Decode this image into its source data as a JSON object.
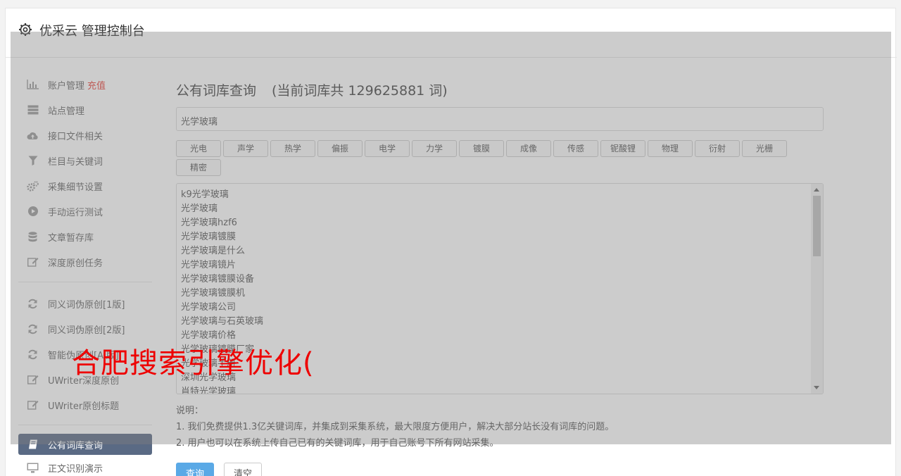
{
  "header": {
    "title": "优采云 管理控制台",
    "icon": "gear-icon"
  },
  "sidebar": {
    "items": [
      {
        "label": "账户管理",
        "tag": "充值",
        "icon": "bar-chart-icon"
      },
      {
        "label": "站点管理",
        "icon": "server-icon"
      },
      {
        "label": "接口文件相关",
        "icon": "cloud-upload-icon"
      },
      {
        "label": "栏目与关键词",
        "icon": "filter-icon"
      },
      {
        "label": "采集细节设置",
        "icon": "cogs-icon"
      },
      {
        "label": "手动运行测试",
        "icon": "play-circle-icon"
      },
      {
        "label": "文章暂存库",
        "icon": "database-icon"
      },
      {
        "label": "深度原创任务",
        "icon": "edit-icon"
      }
    ],
    "items2": [
      {
        "label": "同义词伪原创[1版]",
        "icon": "refresh-icon"
      },
      {
        "label": "同义词伪原创[2版]",
        "icon": "refresh-icon"
      },
      {
        "label": "智能伪原创[AI版]",
        "icon": "refresh-icon"
      },
      {
        "label": "UWriter深度原创",
        "icon": "edit-icon"
      },
      {
        "label": "UWriter原创标题",
        "icon": "edit-icon"
      }
    ],
    "items3": [
      {
        "label": "公有词库查询",
        "icon": "book-icon",
        "active": true
      },
      {
        "label": "正文识别演示",
        "icon": "monitor-icon"
      }
    ]
  },
  "main": {
    "title": "公有词库查询",
    "count_text": "(当前词库共 129625881 词)",
    "search_value": "光学玻璃",
    "categories": [
      "光电",
      "声学",
      "热学",
      "偏振",
      "电学",
      "力学",
      "镀膜",
      "成像",
      "传感",
      "铌酸锂",
      "物理",
      "衍射",
      "光栅",
      "精密"
    ],
    "results": [
      "k9光学玻璃",
      "光学玻璃",
      "光学玻璃hzf6",
      "光学玻璃镀膜",
      "光学玻璃是什么",
      "光学玻璃镜片",
      "光学玻璃镀膜设备",
      "光学玻璃镀膜机",
      "光学玻璃公司",
      "光学玻璃与石英玻璃",
      "光学玻璃价格",
      "光学玻璃镀膜厂家",
      "光学玻璃手册",
      "深圳光学玻璃",
      "肖特光学玻璃"
    ],
    "notes": {
      "heading": "说明：",
      "lines": [
        "1. 我们免费提供1.3亿关键词库，并集成到采集系统，最大限度方便用户，解决大部分站长没有词库的问题。",
        "2. 用户也可以在系统上传自己已有的关键词库，用于自己账号下所有网站采集。"
      ]
    },
    "buttons": {
      "query": "查询",
      "clear": "清空"
    }
  },
  "watermark": "合肥搜索引擎优化("
}
